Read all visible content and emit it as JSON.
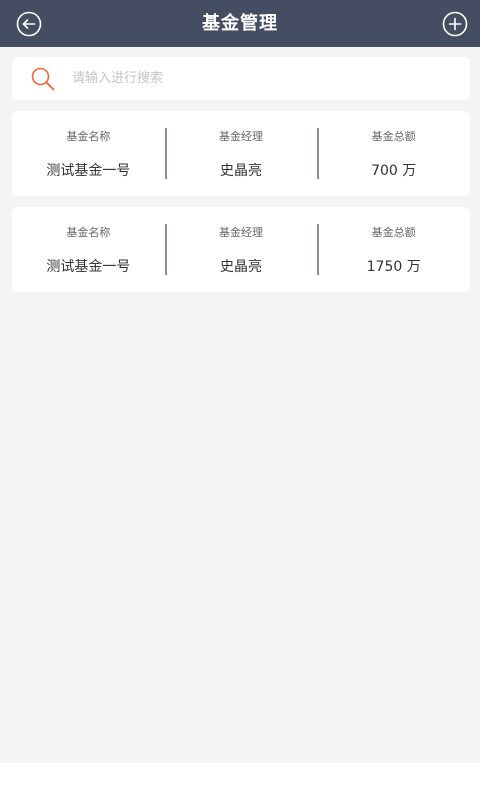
{
  "header": {
    "title": "基金管理",
    "back_icon": "back-circle-icon",
    "add_icon": "add-circle-icon",
    "bg_color": "#454d63"
  },
  "search": {
    "placeholder": "请输入进行搜索",
    "value": "",
    "icon": "search-icon",
    "icon_color": "#f0643c"
  },
  "funds": [
    {
      "name_label": "基金名称",
      "name": "测试基金一号",
      "manager_label": "基金经理",
      "manager": "史晶亮",
      "amount_label": "基金总额",
      "amount": "700 万"
    },
    {
      "name_label": "基金名称",
      "name": "测试基金一号",
      "manager_label": "基金经理",
      "manager": "史晶亮",
      "amount_label": "基金总额",
      "amount": "1750 万"
    }
  ]
}
